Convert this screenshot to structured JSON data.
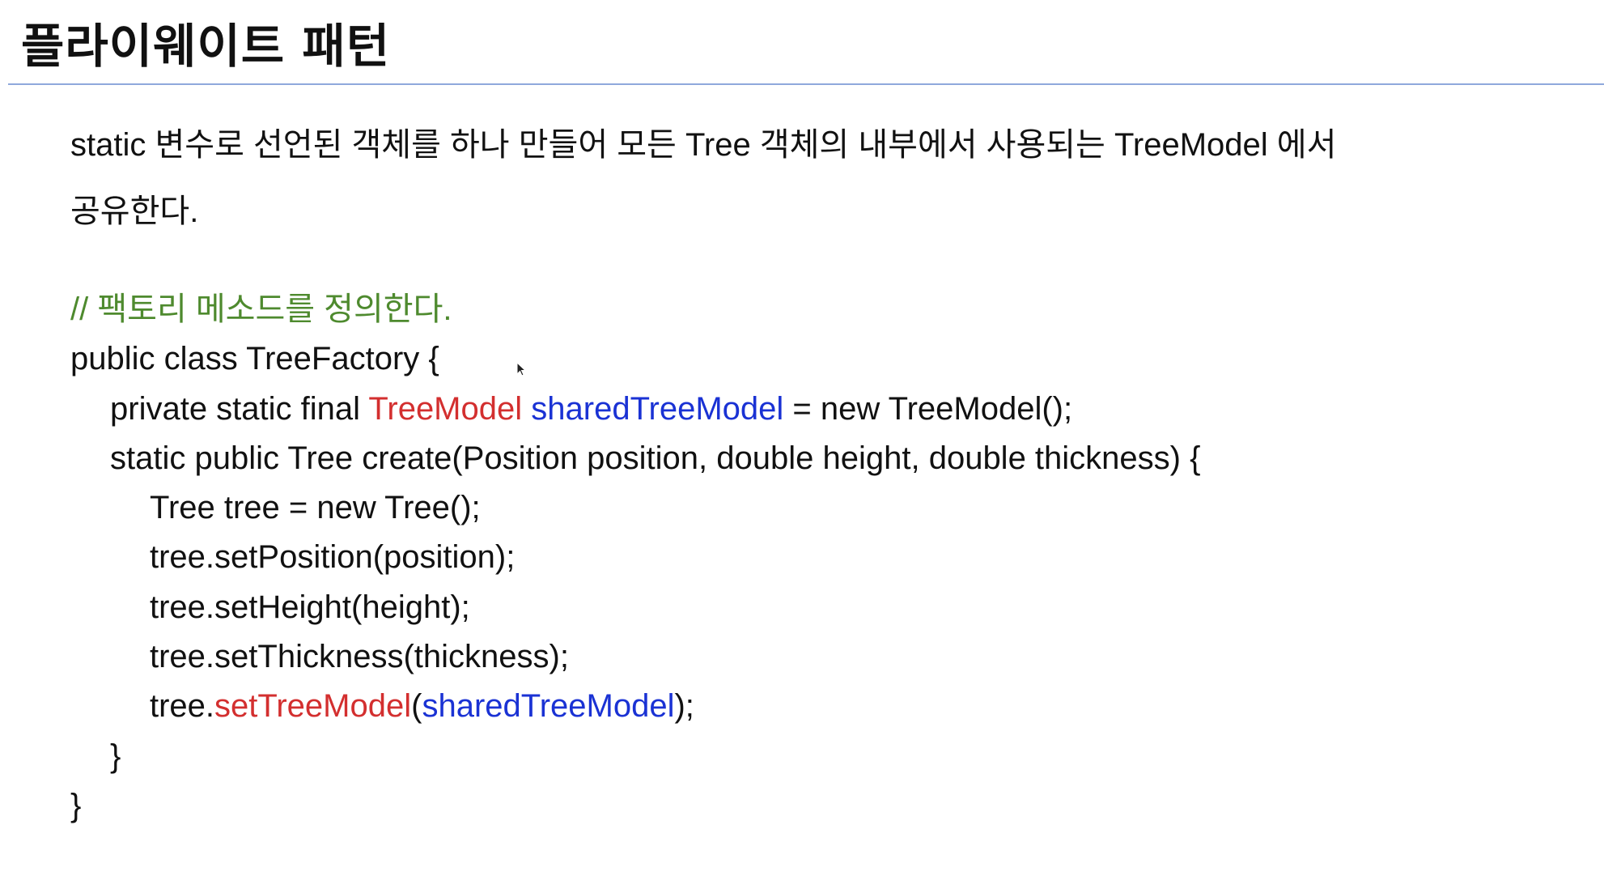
{
  "slide": {
    "title": "플라이웨이트 패턴",
    "description_line1": "static 변수로 선언된 객체를 하나 만들어 모든 Tree 객체의 내부에서 사용되는 TreeModel 에서",
    "description_line2": "공유한다."
  },
  "code": {
    "comment": "// 팩토리 메소드를 정의한다.",
    "class_decl": "public class TreeFactory {",
    "field": {
      "prefix": "private static final ",
      "type": "TreeModel",
      "space": " ",
      "name": "sharedTreeModel",
      "suffix": " = new TreeModel();"
    },
    "method_decl": "static public Tree create(Position position, double height, double thickness) {",
    "stmt_new": "Tree tree = new Tree();",
    "stmt_position": "tree.setPosition(position);",
    "stmt_height": "tree.setHeight(height);",
    "stmt_thickness": "tree.setThickness(thickness);",
    "stmt_model": {
      "prefix": "tree.",
      "method": "setTreeModel",
      "open": "(",
      "arg": "sharedTreeModel",
      "close": ");"
    },
    "method_close": "}",
    "class_close": "}"
  },
  "colors": {
    "comment": "#4e8a2e",
    "highlight_type": "#d32f2f",
    "highlight_var": "#1a32d4",
    "title_rule": "#8fa8dc"
  },
  "icons": {
    "cursor": "mouse-pointer-icon"
  }
}
